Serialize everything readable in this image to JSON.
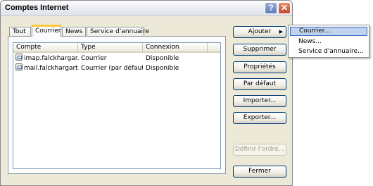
{
  "window": {
    "title": "Comptes Internet",
    "help_glyph": "?",
    "close_glyph": "✕"
  },
  "tabs": [
    {
      "label": "Tout",
      "selected": false
    },
    {
      "label": "Courrier",
      "selected": true
    },
    {
      "label": "News",
      "selected": false
    },
    {
      "label": "Service d'annuaire",
      "selected": false
    }
  ],
  "accounts": {
    "columns": [
      "Compte",
      "Type",
      "Connexion"
    ],
    "rows": [
      {
        "compte": "imap.falckhargar...",
        "type": "Courrier",
        "connexion": "Disponible"
      },
      {
        "compte": "mail.falckhargart...",
        "type": "Courrier (par défaut)",
        "connexion": "Disponible"
      }
    ]
  },
  "buttons": {
    "ajouter": "Ajouter",
    "supprimer": "Supprimer",
    "proprietes": "Propriétés",
    "par_defaut": "Par défaut",
    "importer": "Importer...",
    "exporter": "Exporter...",
    "definir_ordre": "Définir l'ordre...",
    "fermer": "Fermer"
  },
  "add_menu": {
    "items": [
      "Courrier...",
      "News...",
      "Service d'annuaire..."
    ],
    "highlighted": "Courrier..."
  }
}
